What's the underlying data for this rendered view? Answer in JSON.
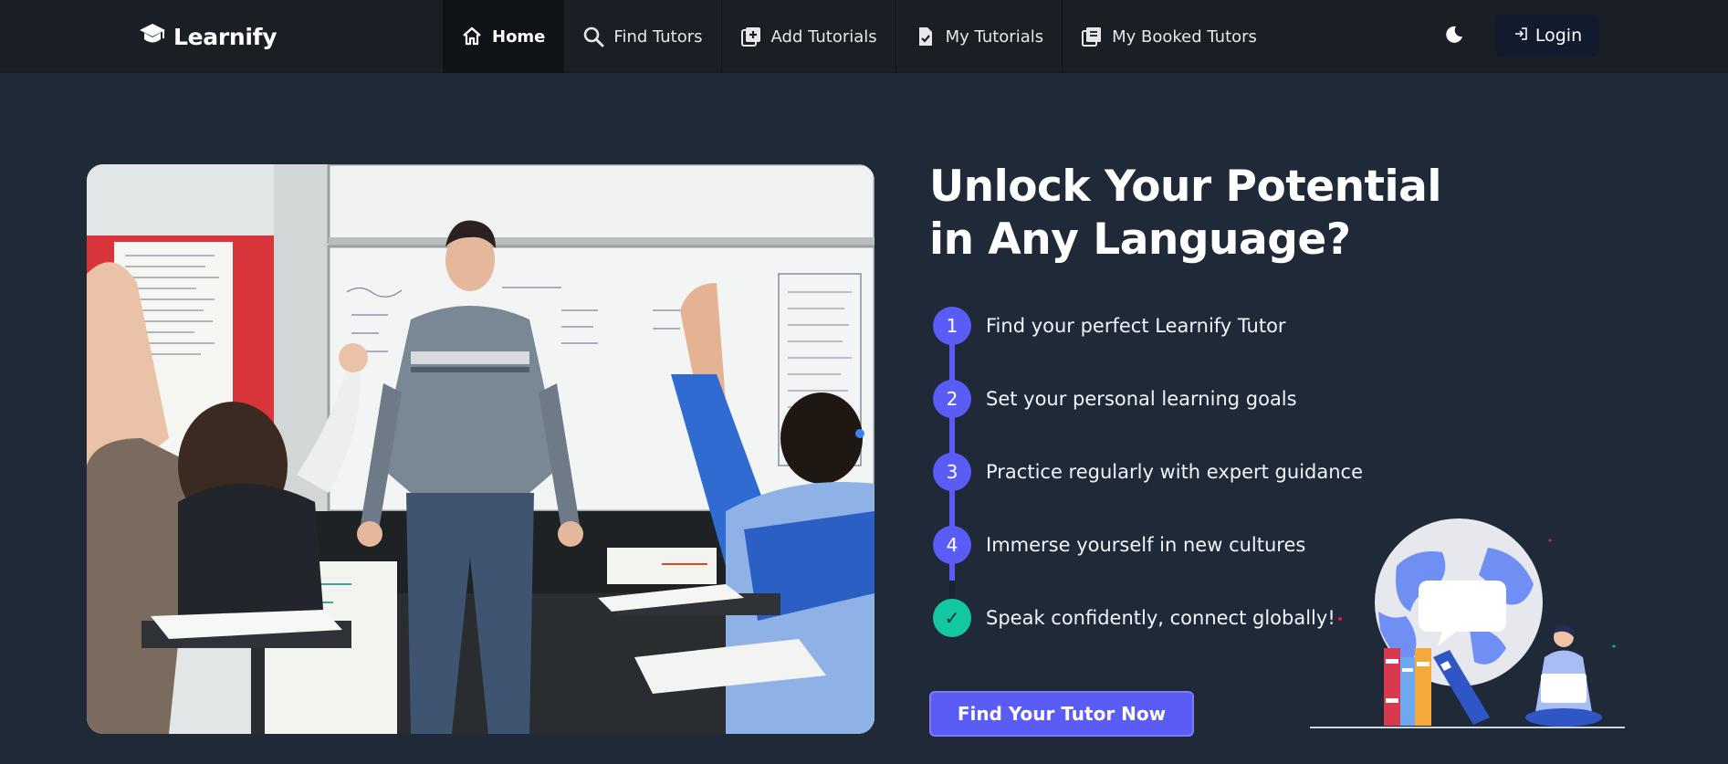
{
  "brand": {
    "name": "Learnify"
  },
  "nav": {
    "items": [
      {
        "label": "Home",
        "icon": "home-icon",
        "active": true
      },
      {
        "label": "Find Tutors",
        "icon": "search-icon"
      },
      {
        "label": "Add Tutorials",
        "icon": "add-box-icon"
      },
      {
        "label": "My Tutorials",
        "icon": "file-check-icon"
      },
      {
        "label": "My Booked Tutors",
        "icon": "library-icon"
      }
    ],
    "theme_toggle_icon": "moon-icon",
    "login_label": "Login",
    "login_icon": "login-icon"
  },
  "hero": {
    "headline_line1": "Unlock Your Potential",
    "headline_line2": "in Any Language?",
    "steps": [
      {
        "marker": "1",
        "text": "Find your perfect Learnify Tutor"
      },
      {
        "marker": "2",
        "text": "Set your personal learning goals"
      },
      {
        "marker": "3",
        "text": "Practice regularly with expert guidance"
      },
      {
        "marker": "4",
        "text": "Immerse yourself in new cultures"
      },
      {
        "marker": "✓",
        "text": "Speak confidently, connect globally!"
      }
    ],
    "cta_label": "Find Your Tutor Now",
    "image_alt": "classroom-photo"
  },
  "colors": {
    "background": "#1f2937",
    "navbar": "#1a1f26",
    "accent": "#5b5cf6",
    "success": "#12c7a2",
    "login_bg": "#121a2e"
  }
}
